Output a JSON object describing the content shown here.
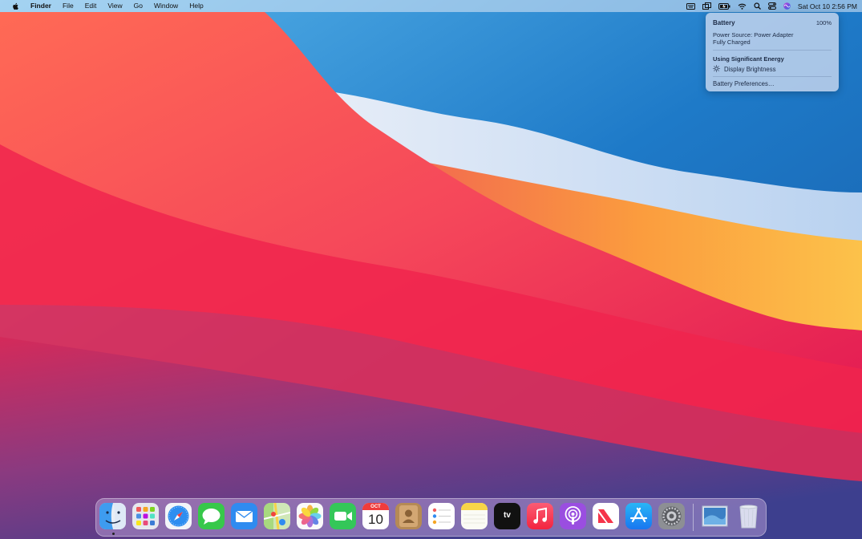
{
  "menubar": {
    "apple_icon": "apple-logo-icon",
    "app_name": "Finder",
    "menus": [
      "File",
      "Edit",
      "View",
      "Go",
      "Window",
      "Help"
    ],
    "status_icons": [
      "keyboard-viewer-icon",
      "screen-mirroring-icon",
      "battery-charging-icon",
      "wifi-icon",
      "spotlight-search-icon",
      "control-center-icon",
      "siri-icon"
    ],
    "clock": "Sat Oct 10  2:56 PM"
  },
  "battery_menu": {
    "title": "Battery",
    "percent": "100%",
    "power_source": "Power Source: Power Adapter",
    "charge_status": "Fully Charged",
    "section_title": "Using Significant Energy",
    "energy_app": "Display Brightness",
    "preferences_label": "Battery Preferences…"
  },
  "dock": {
    "apps": [
      "finder-icon",
      "launchpad-icon",
      "safari-icon",
      "messages-icon",
      "mail-icon",
      "maps-icon",
      "photos-icon",
      "facetime-icon",
      "calendar-icon",
      "contacts-icon",
      "reminders-icon",
      "notes-icon",
      "apple-tv-icon",
      "music-icon",
      "podcasts-icon",
      "news-icon",
      "app-store-icon",
      "system-preferences-icon",
      "downloads-stack-icon",
      "trash-icon"
    ],
    "calendar": {
      "month": "OCT",
      "day": "10"
    },
    "tv_label": "tv"
  },
  "colors": {
    "menubar_bg": "#e1ebf8",
    "popup_bg": "#c8d7ee",
    "wallpaper_blue": "#1e7ac8",
    "wallpaper_red": "#f0244e",
    "wallpaper_orange": "#f9a84a"
  }
}
